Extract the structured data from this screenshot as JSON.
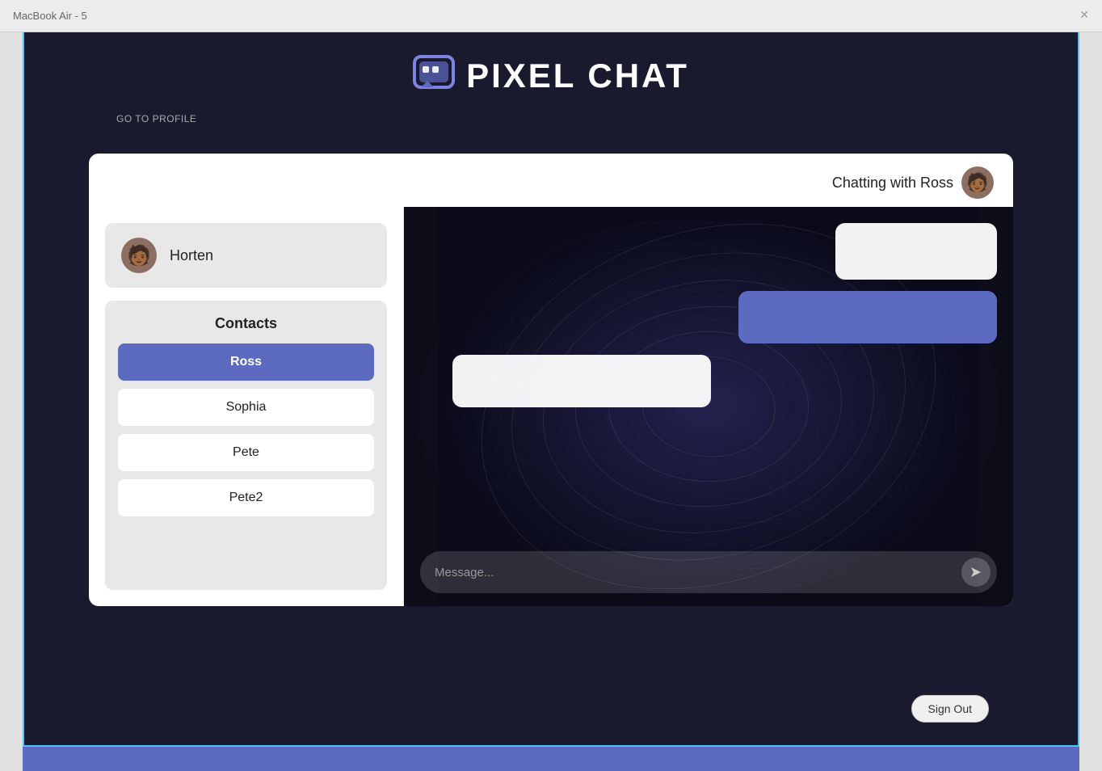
{
  "titleBar": {
    "title": "MacBook Air - 5"
  },
  "header": {
    "appTitle": "PIXEL CHAT",
    "logoIcon": "chat-bubble-icon"
  },
  "nav": {
    "goToProfile": "GO TO PROFILE"
  },
  "chatHeader": {
    "chattingWith": "Chatting with Ross",
    "rossAvatarEmoji": "🧑🏾"
  },
  "user": {
    "name": "Horten",
    "avatarEmoji": "🧑🏾"
  },
  "contacts": {
    "title": "Contacts",
    "list": [
      {
        "name": "Ross",
        "active": true
      },
      {
        "name": "Sophia",
        "active": false
      },
      {
        "name": "Pete",
        "active": false
      },
      {
        "name": "Pete2",
        "active": false
      }
    ]
  },
  "chat": {
    "messages": [
      {
        "type": "white",
        "align": "right",
        "text": ""
      },
      {
        "type": "blue",
        "align": "right",
        "text": ""
      },
      {
        "type": "white",
        "align": "left",
        "text": ""
      }
    ],
    "inputPlaceholder": "Message...",
    "sendIcon": "send-icon"
  },
  "signOut": {
    "label": "Sign Out"
  }
}
